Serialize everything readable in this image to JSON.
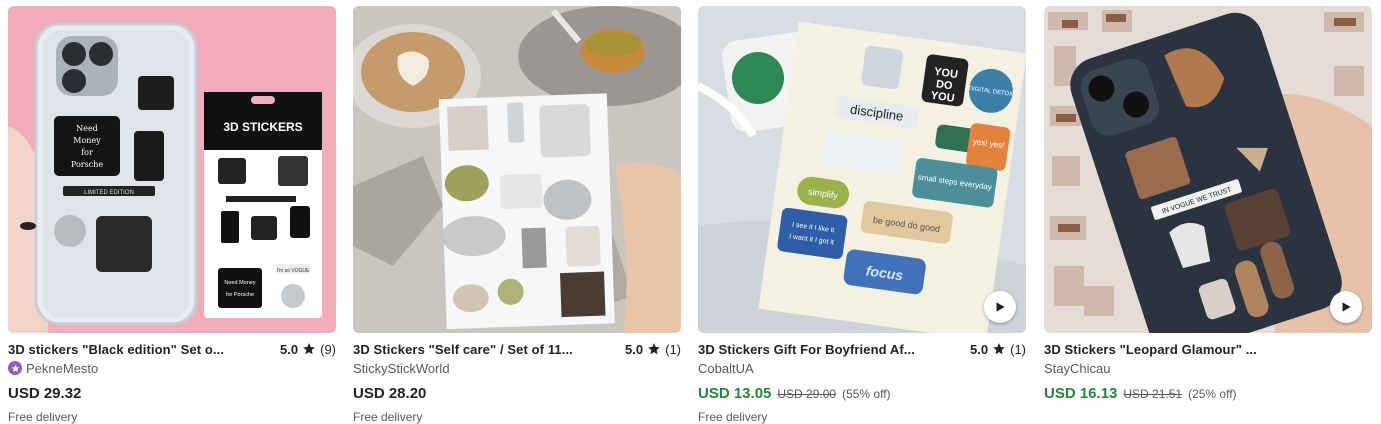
{
  "listings": [
    {
      "title": "3D stickers \"Black edition\" Set o...",
      "rating": "5.0",
      "reviews": "(9)",
      "shop": "PekneMesto",
      "star_seller": true,
      "price": "USD 29.32",
      "original_price": "",
      "discount": "",
      "delivery": "Free delivery",
      "has_video": false,
      "image_text": {
        "package_header": "3D STICKERS",
        "sticker_text": "Need Money for Porsche",
        "limited": "LIMITED EDITION",
        "vogue": "I'm so VOGUE"
      }
    },
    {
      "title": "3D Stickers \"Self care\" / Set of 11...",
      "rating": "5.0",
      "reviews": "(1)",
      "shop": "StickyStickWorld",
      "star_seller": false,
      "price": "USD 28.20",
      "original_price": "",
      "discount": "",
      "delivery": "Free delivery",
      "has_video": false
    },
    {
      "title": "3D Stickers Gift For Boyfriend Af...",
      "rating": "5.0",
      "reviews": "(1)",
      "shop": "CobaltUA",
      "star_seller": false,
      "price": "USD 13.05",
      "original_price": "USD 29.00",
      "discount": "(55% off)",
      "delivery": "Free delivery",
      "has_video": true,
      "image_text": {
        "you_do_you": "YOU DO YOU",
        "discipline": "discipline",
        "simplify": "simplify",
        "yes": "yes! yes!",
        "small_steps": "small steps everyday",
        "be_good": "be good do good",
        "focus": "focus",
        "i_see_it": "I see it I like it I want it I got it",
        "digital_detox": "DIGITAL DETOX"
      }
    },
    {
      "title": "3D Stickers \"Leopard Glamour\" ...",
      "rating": "",
      "reviews": "",
      "shop": "StayChicau",
      "star_seller": false,
      "price": "USD 16.13",
      "original_price": "USD 21.51",
      "discount": "(25% off)",
      "delivery": "",
      "has_video": true,
      "image_text": {
        "vogue_trust": "IN VOGUE WE TRUST"
      }
    }
  ],
  "icons": {
    "star": "star-icon",
    "play": "play-icon",
    "star_seller": "star-seller-badge-icon"
  },
  "colors": {
    "sale_price": "#258635",
    "muted": "#595959",
    "text": "#222222",
    "star_seller_badge": "#8a60c0"
  }
}
